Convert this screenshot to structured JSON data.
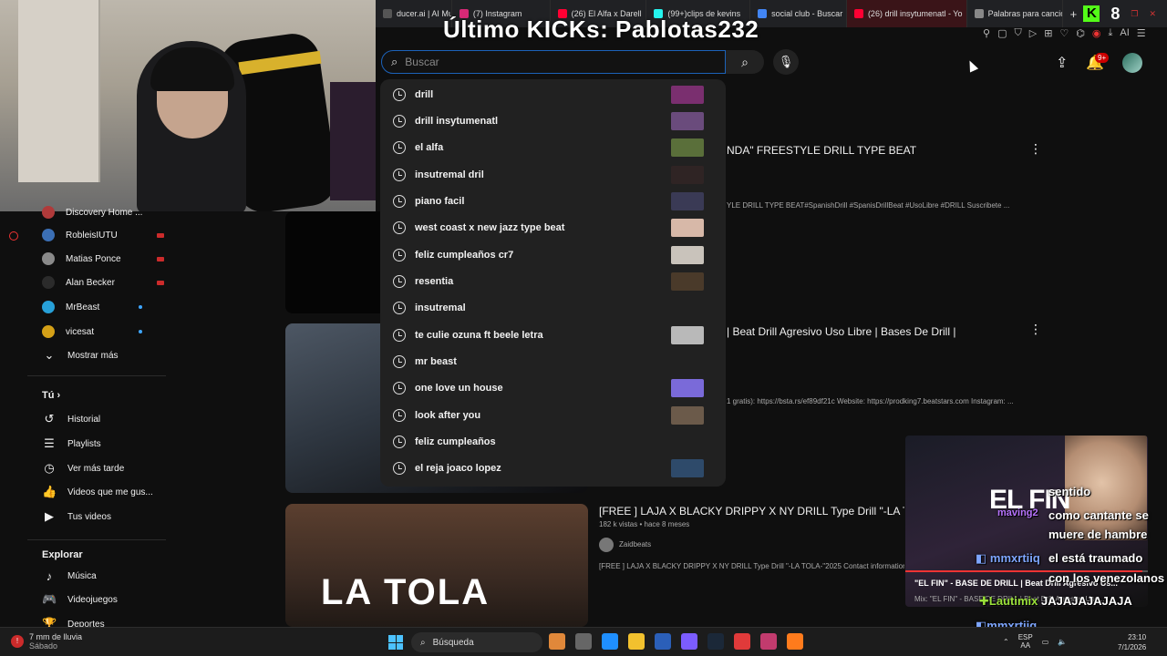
{
  "browser": {
    "tabs": [
      {
        "label": "ducer.ai | AI Musi",
        "color": "#555555"
      },
      {
        "label": "(7) Instagram",
        "color": "#d62976"
      },
      {
        "label": "(26) El Alfa x Darell",
        "color": "#ff0033"
      },
      {
        "label": "(99+)clips de kevins",
        "color": "#25f4ee"
      },
      {
        "label": "social club - Buscar",
        "color": "#4285f4"
      },
      {
        "label": "(26) drill insytumenatl - Yo",
        "color": "#ff0033",
        "active": true
      },
      {
        "label": "Palabras para canció",
        "color": "#888888"
      }
    ],
    "new_tab": "+",
    "kick_letter": "K",
    "kick_viewers": "8",
    "ext_ai": "AI"
  },
  "overlay": {
    "title": "Último KICKs: Pablotas232"
  },
  "youtube": {
    "search_placeholder": "Buscar",
    "notifications_badge": "9+",
    "suggestions": [
      {
        "text": "drill",
        "thumb": "#7a2f6f"
      },
      {
        "text": "drill insytumenatl",
        "thumb": "#6a4b7c"
      },
      {
        "text": "el alfa",
        "thumb": "#5a6f3a"
      },
      {
        "text": "insutremal dril",
        "thumb": "#2f2424"
      },
      {
        "text": "piano facil",
        "thumb": "#3a3a55"
      },
      {
        "text": "west coast x new jazz type beat",
        "thumb": "#d7b8a8"
      },
      {
        "text": "feliz cumpleaños cr7",
        "thumb": "#c9c3bb"
      },
      {
        "text": "resentia",
        "thumb": "#4a3a2a"
      },
      {
        "text": "insutremal",
        "thumb": ""
      },
      {
        "text": "te culie ozuna ft beele letra",
        "thumb": "#b9b9b9"
      },
      {
        "text": "mr beast",
        "thumb": ""
      },
      {
        "text": "one love un house",
        "thumb": "#7a6ad9"
      },
      {
        "text": "look after you",
        "thumb": "#6b5a4a"
      },
      {
        "text": "feliz cumpleaños",
        "thumb": ""
      },
      {
        "text": "el reja joaco lopez",
        "thumb": "#2e4a6a"
      }
    ]
  },
  "sidebar": {
    "subscriptions": [
      {
        "label": "Discovery Home ...",
        "avatar": "#b03a3a",
        "status": "none"
      },
      {
        "label": "RobleisIUTU",
        "avatar": "#3b6fb5",
        "status": "live"
      },
      {
        "label": "Matias Ponce",
        "avatar": "#8a8a8a",
        "status": "live"
      },
      {
        "label": "Alan Becker",
        "avatar": "#2b2b2b",
        "status": "live"
      },
      {
        "label": "MrBeast",
        "avatar": "#27a0d8",
        "status": "dot"
      },
      {
        "label": "vicesat",
        "avatar": "#d4a017",
        "status": "dot"
      }
    ],
    "show_more": "Mostrar más",
    "you_header": "Tú",
    "you_items": [
      "Historial",
      "Playlists",
      "Ver más tarde",
      "Videos que me gus...",
      "Tus videos"
    ],
    "explore_header": "Explorar",
    "explore_items": [
      "Música",
      "Videojuegos",
      "Deportes"
    ]
  },
  "videos": [
    {
      "title": "NDA\" FREESTYLE DRILL TYPE BEAT",
      "desc": "YLE DRILL TYPE BEAT#SpanishDrill #SpanisDrillBeat #UsoLibre #DRILL Suscribete ..."
    },
    {
      "title": "| Beat Drill Agresivo Uso Libre | Bases De Drill |",
      "desc": "1 gratis): https://bsta.rs/ef89df21c Website: https://prodking7.beatstars.com Instagram: ..."
    },
    {
      "title": "[FREE ] LAJA X BLACKY DRIPPY X NY DRILL Type Drill \"-LA TOLA",
      "meta": "182 k vistas • hace 8 meses",
      "channel": "Zaidbeats",
      "desc": "[FREE ] LAJA X BLACKY DRIPPY X NY DRILL Type Drill \"-LA TOLA-\"2025 Contact information: P",
      "thumb_text": "LA TOLA"
    }
  ],
  "pip": {
    "overlay_text": "EL FIN",
    "title": "\"EL FIN\" - BASE DE DRILL | Beat Drill Agresivo Us...",
    "subtitle": "Mix: \"EL FIN\" - BASE DE DRILL | Beat Drill Agresivo Uso..."
  },
  "chat": [
    {
      "user": "maving2",
      "message": "sentido",
      "style": "purple"
    },
    {
      "user": "",
      "message": "como cantante se",
      "style": ""
    },
    {
      "user": "",
      "message": "muere de hambre",
      "style": ""
    },
    {
      "user": "mmxrtiiq",
      "message": "el está traumado",
      "style": ""
    },
    {
      "user": "",
      "message": "con los venezolanos",
      "style": ""
    },
    {
      "user": "Lautimix",
      "message": "JAJAJAJAJAJA",
      "style": "green"
    },
    {
      "user": "mmxrtiiq",
      "message": "",
      "style": ""
    },
    {
      "user": "mmxrtiiq",
      "message": "",
      "style": ""
    }
  ],
  "taskbar": {
    "weather_temp": "7 mm de lluvia",
    "weather_day": "Sábado",
    "search": "Búsqueda",
    "apps": [
      "#e0883a",
      "#666666",
      "#1f8fff",
      "#f2c12e",
      "#2b5fb8",
      "#7b5cff",
      "#1b2838",
      "#e03a3a",
      "#c23b6e",
      "#ff7b1c"
    ],
    "lang": "ESP",
    "lang2": "AA",
    "time": "23:10",
    "date": "7/1/2026"
  }
}
